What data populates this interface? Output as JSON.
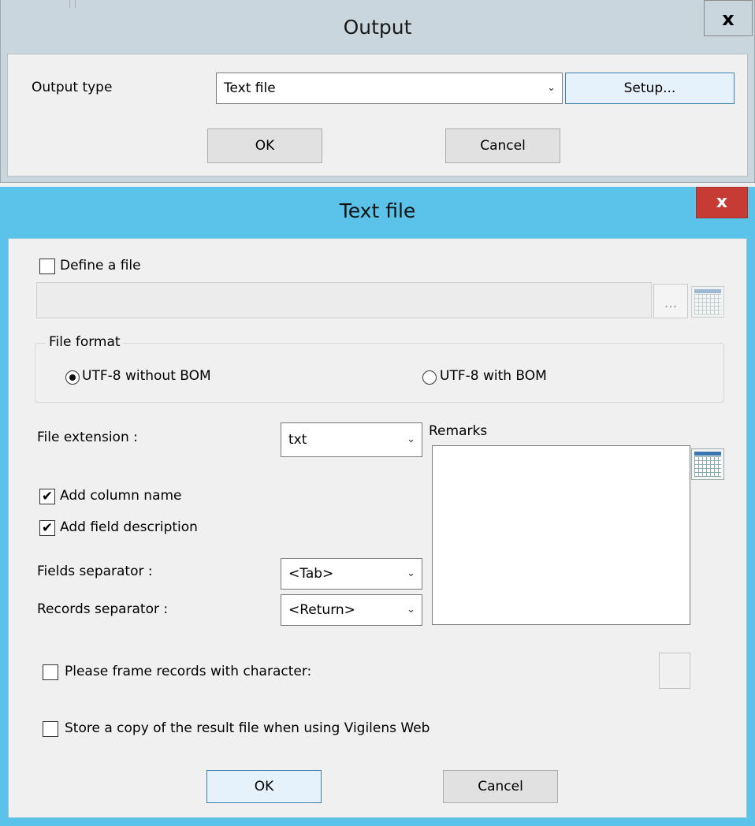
{
  "output_dialog": {
    "title": "Output",
    "close_glyph": "x",
    "output_type_label": "Output type",
    "output_type_value": "Text file",
    "setup_label": "Setup...",
    "ok_label": "OK",
    "cancel_label": "Cancel"
  },
  "text_file_dialog": {
    "title": "Text file",
    "close_glyph": "x",
    "define_file": {
      "label": "Define a file",
      "checked": false
    },
    "file_path_value": "",
    "browse_label": "...",
    "file_format": {
      "label": "File format",
      "options": [
        {
          "label": "UTF-8 without BOM",
          "selected": true
        },
        {
          "label": "UTF-8 with BOM",
          "selected": false
        }
      ]
    },
    "file_extension": {
      "label": "File extension :",
      "value": "txt"
    },
    "remarks_label": "Remarks",
    "remarks_value": "",
    "add_column_name": {
      "label": "Add column name",
      "checked": true
    },
    "add_field_description": {
      "label": "Add field description",
      "checked": true
    },
    "fields_separator": {
      "label": "Fields separator :",
      "value": "<Tab>"
    },
    "records_separator": {
      "label": "Records separator :",
      "value": "<Return>"
    },
    "frame_records": {
      "label": "Please frame records with character:",
      "checked": false,
      "value": ""
    },
    "store_copy": {
      "label": "Store a copy of the result file when using Vigilens Web",
      "checked": false
    },
    "ok_label": "OK",
    "cancel_label": "Cancel",
    "check_glyph": "✔",
    "dropdown_glyph": "⌄"
  },
  "colors": {
    "output_titlebar": "#c9d6de",
    "textfile_titlebar": "#5bc3ea",
    "close_button_red": "#c63b33",
    "dialog_background": "#f0f0f0"
  },
  "icons": {
    "calendar": "calendar-icon",
    "browse": "ellipsis-icon",
    "dropdown": "chevron-down-icon",
    "close": "close-icon"
  }
}
